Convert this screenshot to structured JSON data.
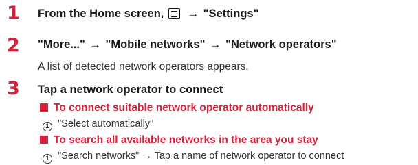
{
  "accent_color": "#d8203a",
  "steps": [
    {
      "number": "1",
      "title_before_icon": "From the Home screen,",
      "icon": "menu-icon",
      "arrow": "→",
      "title_after_icon": "\"Settings\""
    },
    {
      "number": "2",
      "title_parts": [
        "\"More...\"",
        "\"Mobile networks\"",
        "\"Network operators\""
      ],
      "arrow": "→",
      "description": "A list of detected network operators appears."
    },
    {
      "number": "3",
      "title": "Tap a network operator to connect",
      "subsections": [
        {
          "heading": "To connect suitable network operator automatically",
          "item_number": "1",
          "item_text": "\"Select automatically\""
        },
        {
          "heading": "To search all available networks in the area you stay",
          "item_number": "1",
          "item_text_before": "\"Search networks\"",
          "arrow": "→",
          "item_text_after": "Tap a name of network operator to connect"
        }
      ]
    }
  ]
}
